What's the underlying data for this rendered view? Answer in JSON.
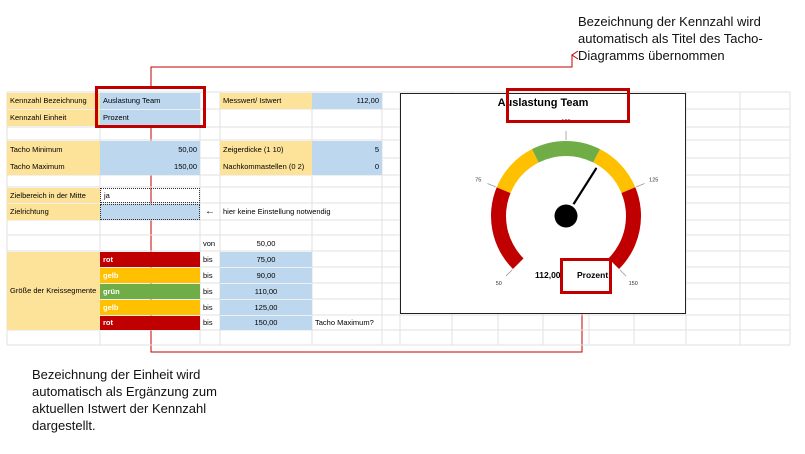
{
  "annotations": {
    "top": "Bezeichnung der Kennzahl wird automatisch als Titel des Tacho-Diagramms übernommen",
    "bottom": "Bezeichnung der Einheit wird automatisch als Ergänzung zum aktuellen Istwert der Kennzahl dargestellt."
  },
  "sheet": {
    "kennzahl_bezeichnung_label": "Kennzahl Bezeichnung",
    "kennzahl_bezeichnung_value": "Auslastung Team",
    "kennzahl_einheit_label": "Kennzahl Einheit",
    "kennzahl_einheit_value": "Prozent",
    "messwert_label": "Messwert/ Istwert",
    "messwert_value": "112,00",
    "tacho_min_label": "Tacho Minimum",
    "tacho_min_value": "50,00",
    "tacho_max_label": "Tacho Maximum",
    "tacho_max_value": "150,00",
    "zeigerdicke_label": "Zeigerdicke (1 10)",
    "zeigerdicke_value": "5",
    "nachkomma_label": "Nachkommastellen (0 2)",
    "nachkomma_value": "0",
    "zielbereich_label": "Zielbereich in der Mitte",
    "zielbereich_value": "ja",
    "zielrichtung_label": "Zielrichtung",
    "zielrichtung_value": "",
    "hint_arrow": "←",
    "hint_text": "hier keine Einstellung notwendig",
    "von_label": "von",
    "von_value": "50,00",
    "segments_label": "Größe der Kreissegmente",
    "bis_label": "bis",
    "tacho_max_hint": "Tacho Maximum?",
    "segments": [
      {
        "name": "rot",
        "value": "75,00",
        "color": "#c00000"
      },
      {
        "name": "gelb",
        "value": "90,00",
        "color": "#ffc000"
      },
      {
        "name": "grün",
        "value": "110,00",
        "color": "#70ad47"
      },
      {
        "name": "gelb",
        "value": "125,00",
        "color": "#ffc000"
      },
      {
        "name": "rot",
        "value": "150,00",
        "color": "#c00000"
      }
    ]
  },
  "chart_data": {
    "type": "gauge",
    "title": "Auslastung Team",
    "min": 50,
    "max": 150,
    "value": 112,
    "value_label": "112,00",
    "unit": "Prozent",
    "ticks": [
      {
        "value": 50,
        "label": "50"
      },
      {
        "value": 75,
        "label": "75"
      },
      {
        "value": 100,
        "label": "100"
      },
      {
        "value": 125,
        "label": "125"
      },
      {
        "value": 150,
        "label": "150"
      }
    ],
    "bands": [
      {
        "from": 50,
        "to": 75,
        "color": "#c00000"
      },
      {
        "from": 75,
        "to": 90,
        "color": "#ffc000"
      },
      {
        "from": 90,
        "to": 110,
        "color": "#70ad47"
      },
      {
        "from": 110,
        "to": 125,
        "color": "#ffc000"
      },
      {
        "from": 125,
        "to": 150,
        "color": "#c00000"
      }
    ],
    "needle_color": "#000000",
    "hub_color": "#000000",
    "highlight_color": "#c00000"
  }
}
